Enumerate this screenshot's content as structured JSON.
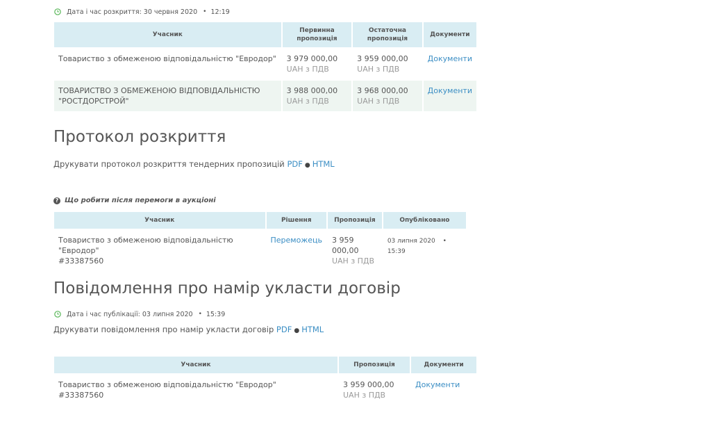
{
  "opening": {
    "datetime_label": "Дата і час розкриття: 30 червня 2020",
    "time": "12:19",
    "table": {
      "headers": [
        "Учасник",
        "Первинна пропозиція",
        "Остаточна пропозиція",
        "Документи"
      ],
      "rows": [
        {
          "participant": "Товариство з обмеженою відповідальністю \"Евродор\"",
          "initial_amount": "3 979 000,00",
          "initial_note": "UAH з ПДВ",
          "final_amount": "3 959 000,00",
          "final_note": "UAH з ПДВ",
          "docs": "Документи"
        },
        {
          "participant": "ТОВАРИСТВО З ОБМЕЖЕНОЮ ВІДПОВІДАЛЬНІСТЮ \"РОСТДОРСТРОЙ\"",
          "initial_amount": "3 988 000,00",
          "initial_note": "UAH з ПДВ",
          "final_amount": "3 968 000,00",
          "final_note": "UAH з ПДВ",
          "docs": "Документи"
        }
      ]
    }
  },
  "protocol": {
    "title": "Протокол розкриття",
    "print_text": "Друкувати протокол розкриття тендерних пропозицій",
    "pdf": "PDF",
    "html": "HTML"
  },
  "award": {
    "hint": "Що робити після перемоги в аукціоні",
    "table": {
      "headers": [
        "Учасник",
        "Рішення",
        "Пропозиція",
        "Опубліковано"
      ],
      "row": {
        "participant": "Товариство з обмеженою відповідальністю \"Евродор\"",
        "participant_id": "#33387560",
        "decision": "Переможець",
        "amount": "3 959 000,00",
        "amount_note": "UAH з ПДВ",
        "published_date": "03 липня 2020",
        "published_time": "15:39"
      }
    }
  },
  "intent": {
    "title": "Повідомлення про намір укласти договір",
    "datetime_label": "Дата і час публікації: 03 липня 2020",
    "time": "15:39",
    "print_text": "Друкувати повідомлення про намір укласти договір",
    "pdf": "PDF",
    "html": "HTML",
    "table": {
      "headers": [
        "Учасник",
        "Пропозиція",
        "Документи"
      ],
      "row": {
        "participant": "Товариство з обмеженою відповідальністю \"Евродор\"",
        "participant_id": "#33387560",
        "amount": "3 959 000,00",
        "amount_note": "UAH з ПДВ",
        "docs": "Документи"
      }
    }
  },
  "colors": {
    "header_bg": "#d9edf3",
    "alt_row_bg": "#eef5f1",
    "link": "#3b8ec4",
    "clock_icon": "#5cb85c"
  },
  "icons": {
    "clock": "clock-icon",
    "question": "question-circle-icon"
  }
}
